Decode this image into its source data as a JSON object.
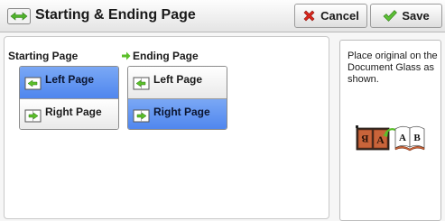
{
  "header": {
    "title": "Starting & Ending Page",
    "title_icon": "double-arrow-icon",
    "cancel_label": "Cancel",
    "cancel_icon": "red-x-icon",
    "save_label": "Save",
    "save_icon": "green-check-icon"
  },
  "starting_page": {
    "label": "Starting Page",
    "options": [
      {
        "label": "Left Page",
        "selected": true
      },
      {
        "label": "Right Page",
        "selected": false
      }
    ]
  },
  "ending_page": {
    "label": "Ending Page",
    "label_icon": "green-arrow-icon",
    "options": [
      {
        "label": "Left Page",
        "selected": false
      },
      {
        "label": "Right Page",
        "selected": true
      }
    ]
  },
  "instructions": {
    "text": "Place original on the Document Glass as shown.",
    "illustration_icon": "book-original-on-glass-icon"
  },
  "colors": {
    "selected_blue": "#5b8ff0",
    "cancel_red": "#d8261c",
    "save_green": "#4caf2e",
    "arrow_green": "#5bbf2a"
  }
}
